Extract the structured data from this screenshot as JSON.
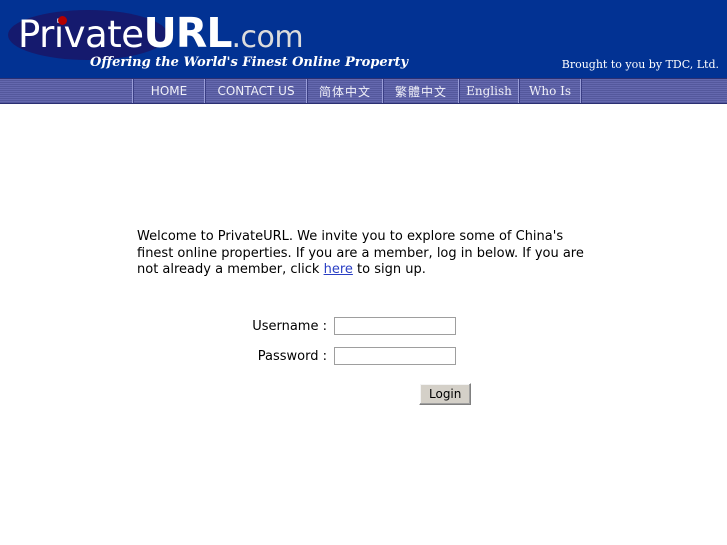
{
  "header": {
    "logo": {
      "part_private": "Private",
      "part_url": "URL",
      "part_com": ".com",
      "tagline": "Offering the World's Finest Online Property",
      "ellipse_color": "#151a6e",
      "dot_color": "#b40000"
    },
    "credit": "Brought to you by TDC, Ltd.",
    "background_color": "#023293"
  },
  "nav": {
    "background_color": "#5b5fa6",
    "items": [
      {
        "label": "HOME",
        "style": "latin"
      },
      {
        "label": "CONTACT US",
        "style": "latin"
      },
      {
        "label": "简体中文",
        "style": "cjk"
      },
      {
        "label": "繁體中文",
        "style": "cjk"
      },
      {
        "label": "English",
        "style": "serif"
      },
      {
        "label": "Who Is",
        "style": "serif"
      }
    ]
  },
  "main": {
    "welcome": {
      "text_before_link": "Welcome to PrivateURL. We invite you to explore some of China's finest online properties. If you are a member, log in below. If you are not already a member, click ",
      "link_text": "here",
      "text_after_link": " to sign up.",
      "link_color": "#2a3fc4"
    },
    "form": {
      "username_label": "Username :",
      "username_value": "",
      "username_placeholder": "",
      "password_label": "Password :",
      "password_value": "",
      "password_placeholder": "",
      "submit_label": "Login"
    }
  }
}
